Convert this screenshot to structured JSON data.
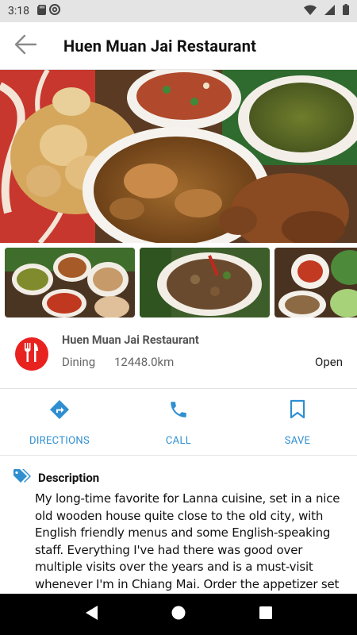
{
  "status_bar": {
    "time": "3:18",
    "icons": [
      "sd-card-icon",
      "at-sign-icon",
      "wifi-icon",
      "signal-icon",
      "battery-icon"
    ]
  },
  "app_bar": {
    "title": "Huen Muan Jai Restaurant",
    "back_icon": "arrow-left-icon"
  },
  "place": {
    "name": "Huen Muan Jai Restaurant",
    "category": "Dining",
    "distance": "12448.0km",
    "status": "Open",
    "category_icon": "fork-knife-icon",
    "category_color": "#e8231f"
  },
  "actions": [
    {
      "label": "DIRECTIONS",
      "icon": "directions-icon"
    },
    {
      "label": "CALL",
      "icon": "phone-icon"
    },
    {
      "label": "SAVE",
      "icon": "bookmark-icon"
    }
  ],
  "description": {
    "title": "Description",
    "icon": "tag-icon",
    "text": "My long-time favorite for Lanna cuisine, set in a nice old wooden house quite close to the old city, with English friendly menus and some English-speaking staff. Everything I've had there was good over multiple visits over the years and is a must-visit whenever I'm in Chiang Mai. Order the appetizer set to try their excellent Sai Oua(Lanna sausage), two Nampriks(spicy green chili and"
  },
  "colors": {
    "accent": "#2f8fd1",
    "category": "#e8231f",
    "status_bar": "#e4e4e4"
  },
  "nav_bar": {
    "buttons": [
      "back-triangle-icon",
      "home-circle-icon",
      "recents-square-icon"
    ]
  }
}
